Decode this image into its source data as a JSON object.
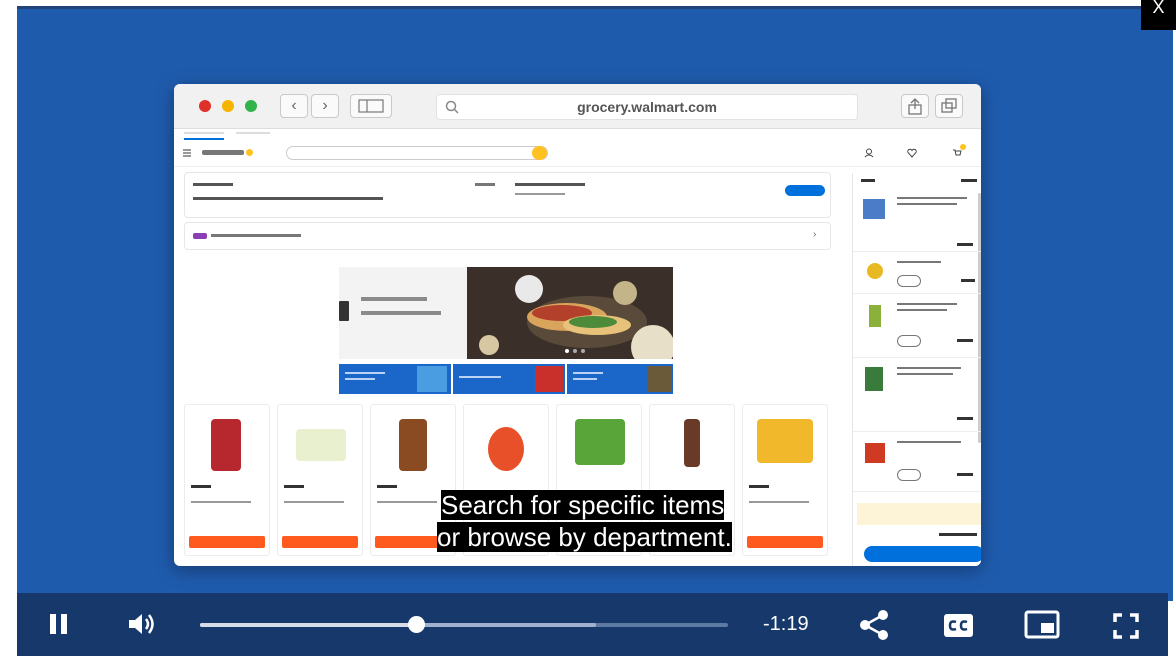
{
  "player": {
    "close_label": "X",
    "time_remaining": "-1:19",
    "progress_fraction": 0.41,
    "buffered_fraction": 0.75,
    "caption_line1": "Search for specific items",
    "caption_line2": "or browse by department."
  },
  "browser": {
    "url": "grocery.walmart.com"
  },
  "colors": {
    "video_bg": "#1f5bad",
    "controls_bg": "#16386a",
    "walmart_blue": "#0071dc",
    "walmart_yellow": "#ffc220",
    "add_to_cart": "#ff5b1f"
  }
}
